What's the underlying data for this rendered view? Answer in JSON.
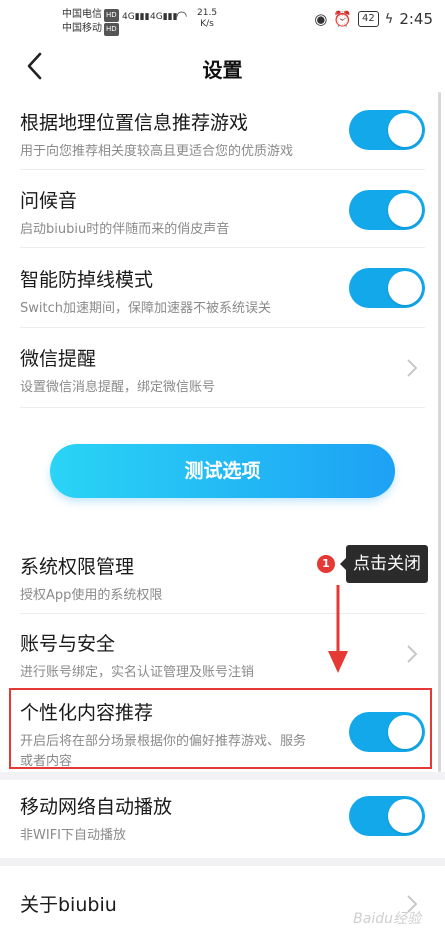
{
  "status": {
    "carrier1": "中国电信",
    "carrier2": "中国移动",
    "hd": "HD",
    "net1": "4G",
    "net2": "4G",
    "speed_value": "21.5",
    "speed_unit": "K/s",
    "battery": "42",
    "time": "2:45"
  },
  "header": {
    "title": "设置"
  },
  "settings": [
    {
      "title": "根据地理位置信息推荐游戏",
      "subtitle": "用于向您推荐相关度较高且更适合您的优质游戏",
      "type": "toggle",
      "on": true
    },
    {
      "title": "问候音",
      "subtitle": "启动biubiu时的伴随而来的俏皮声音",
      "type": "toggle",
      "on": true
    },
    {
      "title": "智能防掉线模式",
      "subtitle": "Switch加速期间，保障加速器不被系统误关",
      "type": "toggle",
      "on": true
    },
    {
      "title": "微信提醒",
      "subtitle": "设置微信消息提醒，绑定微信账号",
      "type": "link"
    }
  ],
  "test_button": "测试选项",
  "settings2": [
    {
      "title": "系统权限管理",
      "subtitle": "授权App使用的系统权限",
      "type": "link"
    },
    {
      "title": "账号与安全",
      "subtitle": "进行账号绑定，实名认证管理及账号注销",
      "type": "link"
    },
    {
      "title": "个性化内容推荐",
      "subtitle_line1": "开启后将在部分场景根据你的偏好推荐游戏、服务",
      "subtitle_line2": "或者内容",
      "type": "toggle",
      "on": true
    },
    {
      "title": "移动网络自动播放",
      "subtitle": "非WIFI下自动播放",
      "type": "toggle",
      "on": true
    },
    {
      "title": "关于biubiu",
      "type": "link"
    }
  ],
  "annotation": {
    "step": "1",
    "text": "点击关闭"
  },
  "watermark": "Baidu经验"
}
